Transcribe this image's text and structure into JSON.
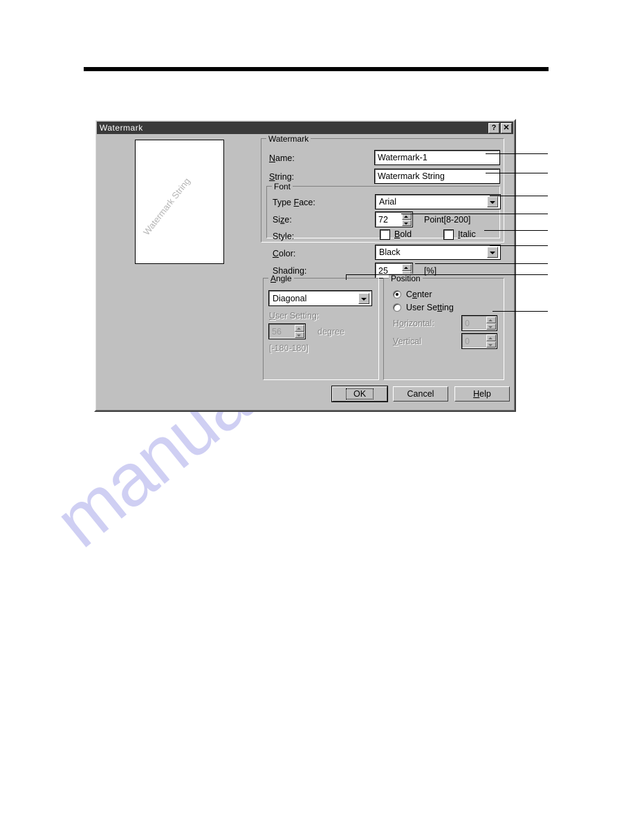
{
  "dialog": {
    "title": "Watermark",
    "titlebar_buttons": [
      {
        "name": "help-button",
        "glyph": "?"
      },
      {
        "name": "close-button",
        "glyph": "✕"
      }
    ],
    "preview": {
      "text": "Watermark String"
    },
    "groups": {
      "watermark": {
        "title": "Watermark",
        "name_label": "Name:",
        "name_accel": "N",
        "name_value": "Watermark-1",
        "string_label": "String:",
        "string_accel": "S",
        "string_value": "Watermark String"
      },
      "font": {
        "title": "Font",
        "typeface_label": "Type Face:",
        "typeface_accel": "F",
        "typeface_value": "Arial",
        "size_label": "Size:",
        "size_accel": "z",
        "size_value": "72",
        "size_hint": "Point[8-200]",
        "style_label": "Style:",
        "bold_label": "Bold",
        "bold_accel": "B",
        "bold_checked": false,
        "italic_label": "Italic",
        "italic_accel": "I",
        "italic_checked": false,
        "color_label": "Color:",
        "color_accel": "C",
        "color_value": "Black",
        "shading_label": "Shading:",
        "shading_accel": "g",
        "shading_value": "25",
        "shading_unit": "[%]"
      },
      "angle": {
        "title": "Angle",
        "title_accel": "A",
        "mode_value": "Diagonal",
        "user_setting_label": "User Setting:",
        "user_setting_accel": "U",
        "degree_value": "56",
        "degree_unit": "degree",
        "range_hint": "[-180-180]",
        "disabled": true
      },
      "position": {
        "title": "Position",
        "center_label": "Center",
        "center_accel": "e",
        "center_selected": true,
        "user_setting_label": "User Setting",
        "user_setting_accel": "tt",
        "user_setting_selected": false,
        "horizontal_label": "Horizontal:",
        "horizontal_accel": "o",
        "horizontal_value": "0",
        "vertical_label": "Vertical",
        "vertical_accel": "V",
        "vertical_value": "0",
        "fields_disabled": true
      }
    },
    "buttons": {
      "ok": "OK",
      "cancel": "Cancel",
      "help": "Help",
      "help_accel": "H"
    }
  },
  "page": {
    "background_watermark": "manualshive.com"
  },
  "colors": {
    "dialog_face": "#c0c0c0",
    "titlebar": "#3a3a3a",
    "watermark_tint": "#ccccf2",
    "disabled_text": "#808080"
  }
}
